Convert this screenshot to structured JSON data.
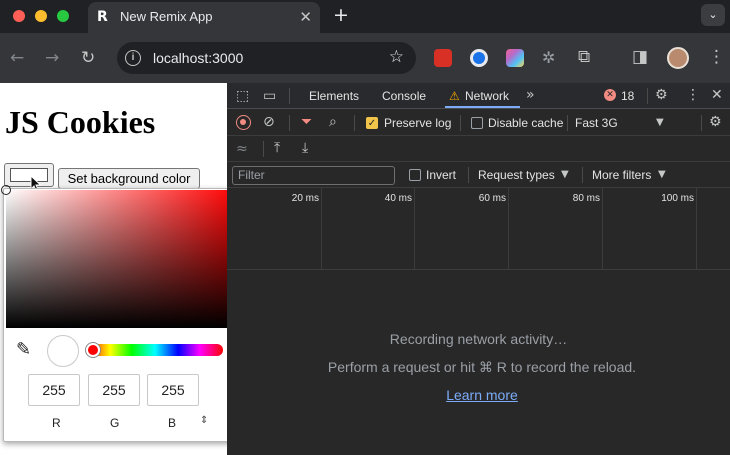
{
  "browser": {
    "tab_title": "New Remix App",
    "tab_favicon": "R",
    "url": "localhost:3000",
    "icons": [
      "back-arrow-icon",
      "forward-arrow-icon",
      "reload-icon",
      "site-info-icon",
      "star-icon",
      "extensions-icon",
      "side-panel-icon",
      "kebab-menu-icon"
    ]
  },
  "page": {
    "title": "JS Cookies",
    "set_background_button": "Set background color",
    "color_input_value": "#ffffff"
  },
  "color_picker": {
    "r": "255",
    "g": "255",
    "b": "255",
    "r_label": "R",
    "g_label": "G",
    "b_label": "B",
    "format_toggle": "⌃⌄",
    "hue_color": "#ff0000"
  },
  "devtools": {
    "tabs": [
      "Elements",
      "Console",
      "Network"
    ],
    "active_tab": "Network",
    "more_tabs": "»",
    "error_count": "18",
    "preserve_log": "Preserve log",
    "preserve_log_checked": true,
    "disable_cache": "Disable cache",
    "disable_cache_checked": false,
    "throttling": "Fast 3G",
    "filter_placeholder": "Filter",
    "invert": "Invert",
    "request_types": "Request types",
    "more_filters": "More filters",
    "timeline_ticks": [
      "20 ms",
      "40 ms",
      "60 ms",
      "80 ms",
      "100 ms"
    ],
    "empty_title": "Recording network activity…",
    "empty_hint": "Perform a request or hit ⌘ R to record the reload.",
    "learn_more": "Learn more",
    "accent_color": "#7cacf8",
    "error_color": "#f28b82"
  }
}
